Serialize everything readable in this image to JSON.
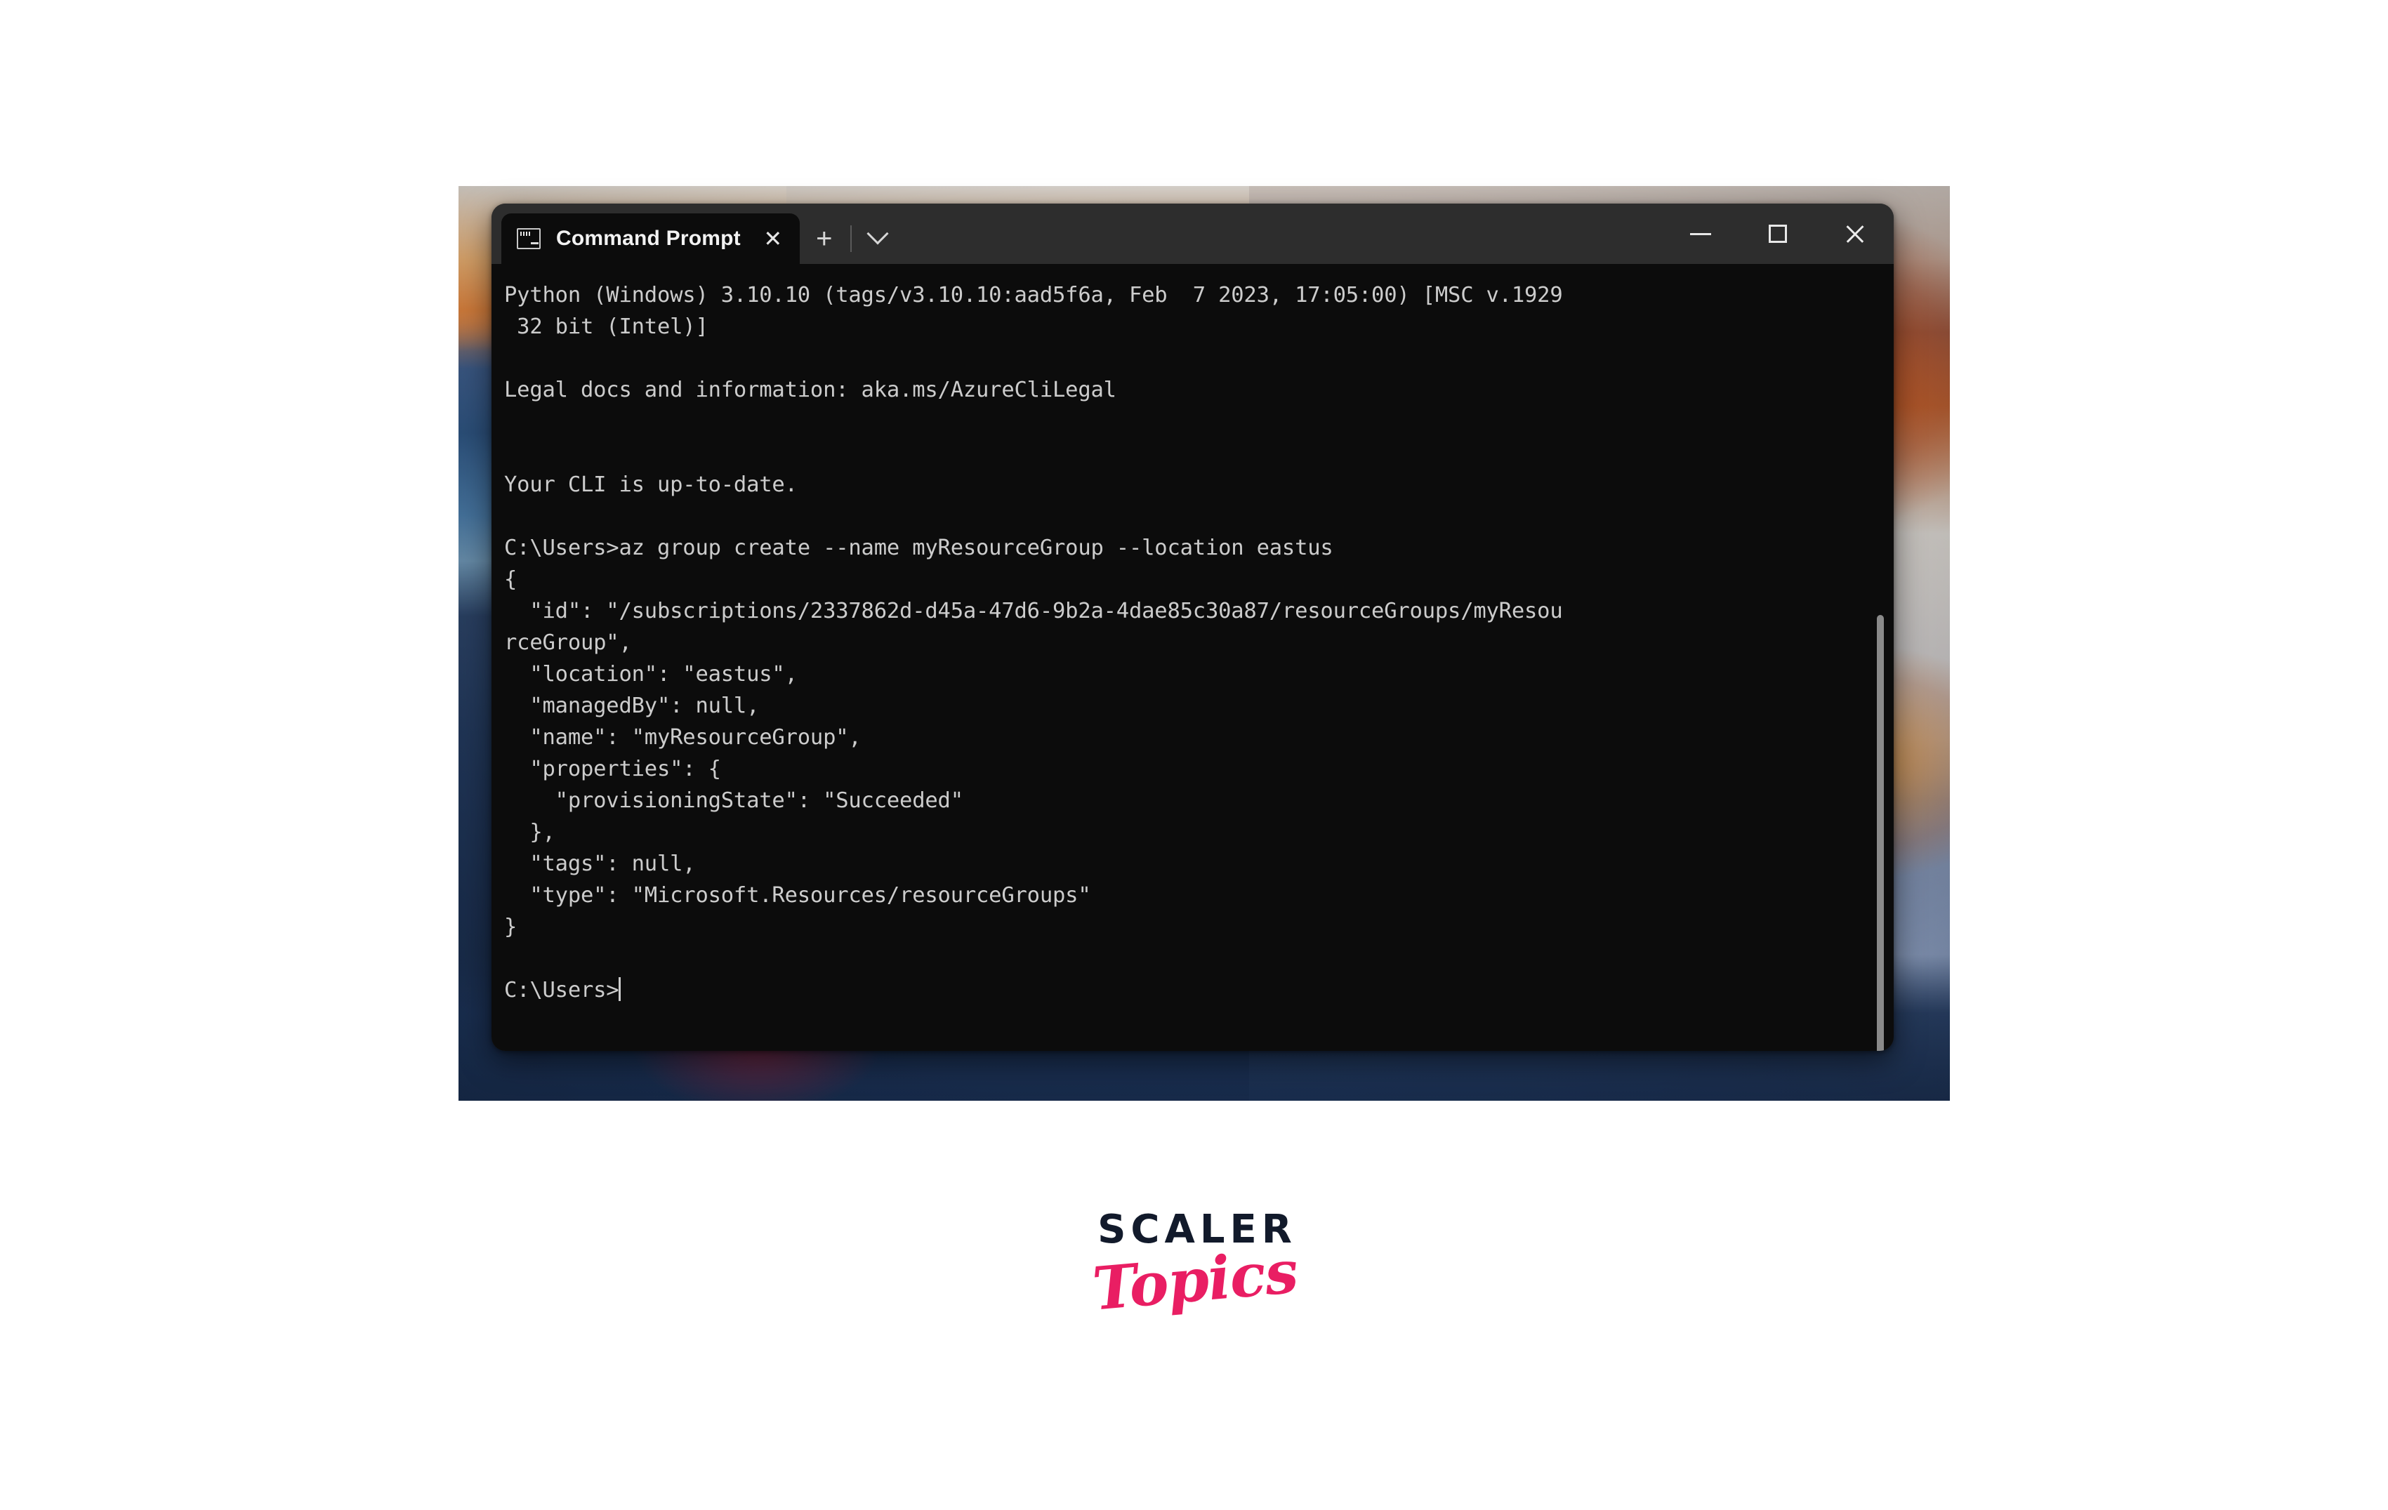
{
  "window": {
    "app_title": "Command Prompt",
    "tab": {
      "label": "Command Prompt",
      "icon": "cmd-icon",
      "close_glyph": "✕"
    },
    "new_tab_glyph": "+",
    "tab_dropdown_glyph": "⌄",
    "controls": {
      "minimize": "–",
      "maximize": "□",
      "close": "✕"
    },
    "chrome_color": "#2d2d2d",
    "console_bg": "#0c0c0c",
    "console_fg": "#cccccc"
  },
  "console": {
    "lines": [
      "Python (Windows) 3.10.10 (tags/v3.10.10:aad5f6a, Feb  7 2023, 17:05:00) [MSC v.1929",
      " 32 bit (Intel)]",
      "",
      "Legal docs and information: aka.ms/AzureCliLegal",
      "",
      "",
      "Your CLI is up-to-date.",
      "",
      "C:\\Users>az group create --name myResourceGroup --location eastus",
      "{",
      "  \"id\": \"/subscriptions/2337862d-d45a-47d6-9b2a-4dae85c30a87/resourceGroups/myResou",
      "rceGroup\",",
      "  \"location\": \"eastus\",",
      "  \"managedBy\": null,",
      "  \"name\": \"myResourceGroup\",",
      "  \"properties\": {",
      "    \"provisioningState\": \"Succeeded\"",
      "  },",
      "  \"tags\": null,",
      "  \"type\": \"Microsoft.Resources/resourceGroups\"",
      "}",
      "",
      ""
    ],
    "prompt": "C:\\Users>",
    "command_entered": "az group create --name myResourceGroup --location eastus",
    "subscription_id": "2337862d-d45a-47d6-9b2a-4dae85c30a87",
    "resource_group_name": "myResourceGroup",
    "location": "eastus",
    "provisioning_state": "Succeeded",
    "resource_type": "Microsoft.Resources/resourceGroups",
    "python_version": "3.10.10",
    "msc_version": "v.1929",
    "legal_url": "aka.ms/AzureCliLegal",
    "cli_status": "Your CLI is up-to-date."
  },
  "logo": {
    "primary": "SCALER",
    "secondary": "Topics",
    "primary_color": "#121a2b",
    "secondary_color": "#e91e63"
  }
}
